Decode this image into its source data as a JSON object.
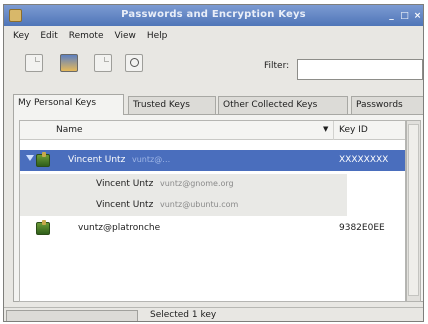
{
  "window": {
    "title": "Passwords and Encryption Keys",
    "controls": [
      "_",
      "□",
      "×"
    ]
  },
  "menubar": [
    "Key",
    "Edit",
    "Remote",
    "View",
    "Help"
  ],
  "toolbar": {
    "icons": [
      "new-key-icon",
      "keys-icon",
      "document-icon",
      "find-remote-keys-icon"
    ],
    "filter_label": "Filter:",
    "filter_value": ""
  },
  "tabs": [
    "My Personal Keys",
    "Trusted Keys",
    "Other Collected Keys",
    "Passwords"
  ],
  "tree": {
    "columns": {
      "name": "Name",
      "keyid": "Key ID"
    },
    "rows": [
      {
        "name": "Vincent Untz",
        "email": "vuntz@…",
        "keyid": "XXXXXXXX"
      },
      {
        "name": "Vincent Untz",
        "email": "vuntz@gnome.org",
        "keyid": ""
      },
      {
        "name": "Vincent Untz",
        "email": "vuntz@ubuntu.com",
        "keyid": ""
      },
      {
        "name": "vuntz@platronche",
        "email": "",
        "keyid": "9382E0EE"
      }
    ]
  },
  "statusbar": {
    "text": "Selected 1 key"
  },
  "colors": {
    "selection": "#4a6ebd",
    "titlebar": "#5b7fc0"
  }
}
